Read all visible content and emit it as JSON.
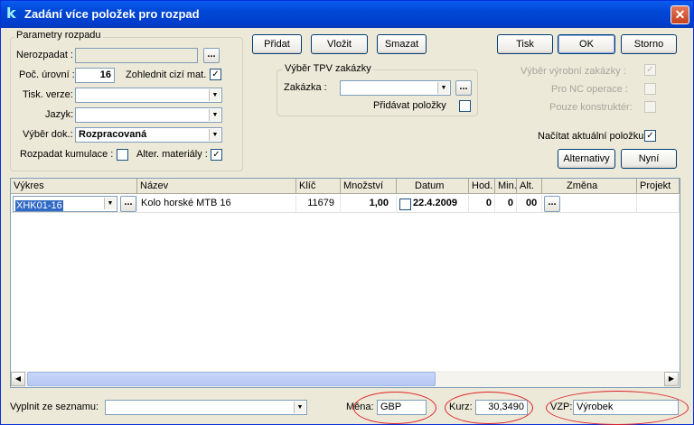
{
  "window": {
    "title": "Zadání více položek pro rozpad",
    "logo": "k"
  },
  "params": {
    "group_title": "Parametry rozpadu",
    "nerozpadat_label": "Nerozpadat :",
    "levels_label": "Poč. úrovní :",
    "levels_value": "16",
    "foreign_label": "Zohlednit cizí mat. :",
    "print_label": "Tisk. verze:",
    "lang_label": "Jazyk:",
    "doc_label": "Výběr dok.:",
    "doc_value": "Rozpracovaná",
    "cumul_label": "Rozpadat kumulace :",
    "alter_label": "Alter. materiály :"
  },
  "toolbar": {
    "add": "Přidat",
    "insert": "Vložit",
    "delete": "Smazat",
    "print": "Tisk",
    "ok": "OK",
    "cancel": "Storno",
    "alternatives": "Alternativy",
    "now": "Nyní"
  },
  "tpv": {
    "group_title": "Výběr TPV zakázky",
    "order_label": "Zakázka :",
    "add_items_label": "Přidávat položky"
  },
  "options": {
    "production_order": "Výběr výrobní zakázky :",
    "nc_ops": "Pro NC operace :",
    "designer_only": "Pouze konstruktér:",
    "load_current": "Načítat aktuální položku"
  },
  "grid": {
    "columns": [
      "Výkres",
      "Název",
      "Klíč",
      "Množství",
      "Datum",
      "Hod.",
      "Min.",
      "Alt.",
      "Změna",
      "Projekt"
    ],
    "rows": [
      {
        "vykres": "XHK01-16",
        "nazev": "Kolo horské MTB 16",
        "klic": "11679",
        "mnozstvi": "1,00",
        "datum": "22.4.2009",
        "hod": "0",
        "min": "0",
        "alt": "00"
      }
    ]
  },
  "footer": {
    "list_label": "Vyplnit ze seznamu:",
    "currency_label": "Měna:",
    "currency_value": "GBP",
    "rate_label": "Kurz:",
    "rate_value": "30,3490",
    "vzp_label": "VZP:",
    "vzp_value": "Výrobek"
  },
  "icons": {
    "close": "close-icon",
    "dropdown": "chevron-down-icon",
    "check": "check-icon"
  },
  "colors": {
    "title_bar": "#0046d5",
    "highlight_ellipse": "#e0202a",
    "selection": "#316ac5"
  }
}
